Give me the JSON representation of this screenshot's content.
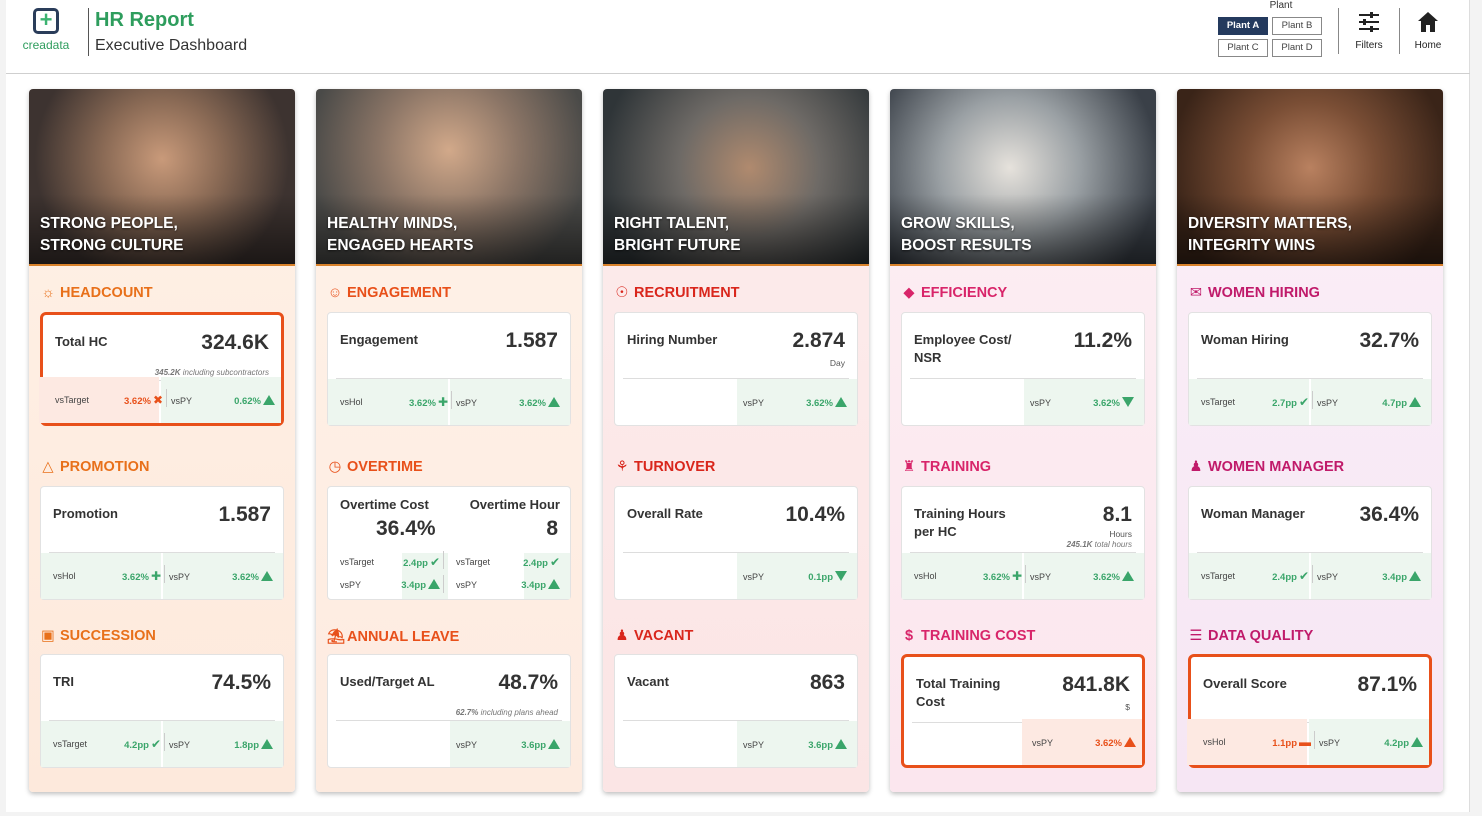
{
  "header": {
    "logo_text": "creadata",
    "title": "HR Report",
    "subtitle": "Executive Dashboard",
    "plant_label": "Plant",
    "plants": [
      "Plant A",
      "Plant B",
      "Plant C",
      "Plant D"
    ],
    "selected_plant": "Plant A",
    "filters_label": "Filters",
    "home_label": "Home"
  },
  "colors": {
    "accent_orange": "#e8501a",
    "accent_green": "#3aa56a",
    "brand_navy": "#243a5e",
    "pink_section": "#d8256a"
  },
  "columns": [
    {
      "caption_1": "STRONG PEOPLE,",
      "caption_2": "STRONG CULTURE",
      "sections": [
        {
          "title": "HEADCOUNT",
          "icon": "group-icon",
          "label": "Total HC",
          "value": "324.6K",
          "note_bold": "345.2K",
          "note": "including subcontractors",
          "c1_label": "vsTarget",
          "c1_value": "3.62%",
          "c1_mark": "x",
          "c2_label": "vsPY",
          "c2_value": "0.62%",
          "c2_mark": "up"
        },
        {
          "title": "PROMOTION",
          "icon": "warning-triangle-icon",
          "label": "Promotion",
          "value": "1.587",
          "c1_label": "vsHol",
          "c1_value": "3.62%",
          "c1_mark": "plus",
          "c2_label": "vsPY",
          "c2_value": "3.62%",
          "c2_mark": "up"
        },
        {
          "title": "SUCCESSION",
          "icon": "monitor-icon",
          "label": "TRI",
          "value": "74.5%",
          "c1_label": "vsTarget",
          "c1_value": "4.2pp",
          "c1_mark": "check",
          "c2_label": "vsPY",
          "c2_value": "1.8pp",
          "c2_mark": "up"
        }
      ]
    },
    {
      "caption_1": "HEALTHY MINDS,",
      "caption_2": "ENGAGED HEARTS",
      "sections": [
        {
          "title": "ENGAGEMENT",
          "icon": "smile-icon",
          "label": "Engagement",
          "value": "1.587",
          "c1_label": "vsHol",
          "c1_value": "3.62%",
          "c1_mark": "plus",
          "c2_label": "vsPY",
          "c2_value": "3.62%",
          "c2_mark": "up"
        },
        {
          "title": "OVERTIME",
          "icon": "clock-icon",
          "left_label": "Overtime Cost",
          "left_value": "36.4%",
          "right_label": "Overtime Hour",
          "right_value": "8",
          "rows": [
            {
              "l_label": "vsTarget",
              "l_value": "2.4pp",
              "l_mark": "check",
              "r_label": "vsTarget",
              "r_value": "2.4pp",
              "r_mark": "check"
            },
            {
              "l_label": "vsPY",
              "l_value": "3.4pp",
              "l_mark": "up",
              "r_label": "vsPY",
              "r_value": "3.4pp",
              "r_mark": "up"
            }
          ]
        },
        {
          "title": "ANNUAL LEAVE",
          "icon": "beach-icon",
          "label": "Used/Target AL",
          "value": "48.7%",
          "note_bold": "62.7%",
          "note": "including plans ahead",
          "c2_label": "vsPY",
          "c2_value": "3.6pp",
          "c2_mark": "up"
        }
      ]
    },
    {
      "caption_1": "RIGHT TALENT,",
      "caption_2": "BRIGHT FUTURE",
      "sections": [
        {
          "title": "RECRUITMENT",
          "icon": "recruit-icon",
          "label": "Hiring Number",
          "value": "2.874",
          "unit": "Day",
          "c2_label": "vsPY",
          "c2_value": "3.62%",
          "c2_mark": "up"
        },
        {
          "title": "TURNOVER",
          "icon": "turnover-icon",
          "label": "Overall Rate",
          "value": "10.4%",
          "c2_label": "vsPY",
          "c2_value": "0.1pp",
          "c2_mark": "down"
        },
        {
          "title": "VACANT",
          "icon": "vacant-icon",
          "label": "Vacant",
          "value": "863",
          "c2_label": "vsPY",
          "c2_value": "3.6pp",
          "c2_mark": "up"
        }
      ]
    },
    {
      "caption_1": "GROW SKILLS,",
      "caption_2": "BOOST RESULTS",
      "sections": [
        {
          "title": "EFFICIENCY",
          "icon": "diamond-icon",
          "label": "Employee Cost/ NSR",
          "value": "11.2%",
          "c2_label": "vsPY",
          "c2_value": "3.62%",
          "c2_mark": "down"
        },
        {
          "title": "TRAINING",
          "icon": "graduation-cap-icon",
          "label": "Training Hours per HC",
          "value": "8.1",
          "unit": "Hours",
          "note_bold": "245.1K",
          "note": "total hours",
          "c1_label": "vsHol",
          "c1_value": "3.62%",
          "c1_mark": "plus",
          "c2_label": "vsPY",
          "c2_value": "3.62%",
          "c2_mark": "up"
        },
        {
          "title": "TRAINING COST",
          "icon": "dollar-icon",
          "label": "Total Training Cost",
          "value": "841.8K",
          "unit": "$",
          "c2_label": "vsPY",
          "c2_value": "3.62%",
          "c2_mark": "up"
        }
      ]
    },
    {
      "caption_1": "DIVERSITY MATTERS,",
      "caption_2": "INTEGRITY WINS",
      "sections": [
        {
          "title": "WOMEN HIRING",
          "icon": "woman-hiring-icon",
          "label": "Woman Hiring",
          "value": "32.7%",
          "c1_label": "vsTarget",
          "c1_value": "2.7pp",
          "c1_mark": "check",
          "c2_label": "vsPY",
          "c2_value": "4.7pp",
          "c2_mark": "up"
        },
        {
          "title": "WOMEN MANAGER",
          "icon": "woman-manager-icon",
          "label": "Woman Manager",
          "value": "36.4%",
          "c1_label": "vsTarget",
          "c1_value": "2.4pp",
          "c1_mark": "check",
          "c2_label": "vsPY",
          "c2_value": "3.4pp",
          "c2_mark": "up"
        },
        {
          "title": "DATA QUALITY",
          "icon": "database-icon",
          "label": "Overall Score",
          "value": "87.1%",
          "c1_label": "vsHol",
          "c1_value": "1.1pp",
          "c1_mark": "minus",
          "c2_label": "vsPY",
          "c2_value": "4.2pp",
          "c2_mark": "up"
        }
      ]
    }
  ]
}
